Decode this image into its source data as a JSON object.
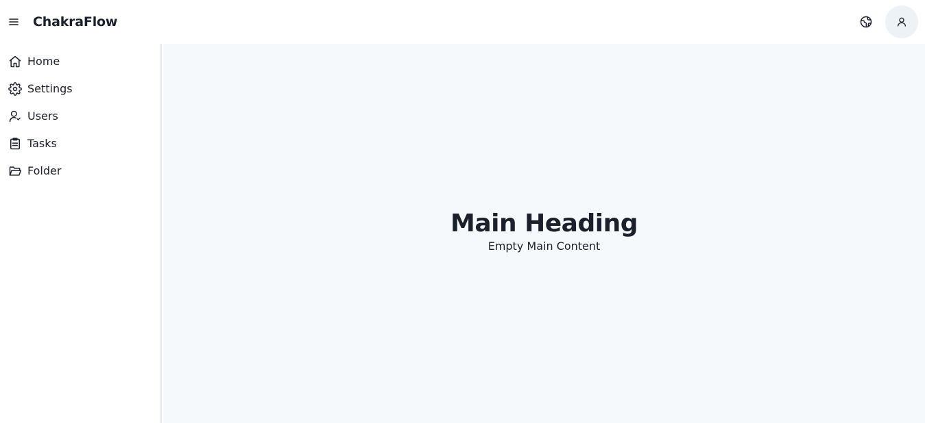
{
  "header": {
    "brand": "ChakraFlow",
    "menu_icon": "hamburger-menu-icon",
    "language_icon": "globe-icon",
    "profile_icon": "user-icon"
  },
  "sidebar": {
    "items": [
      {
        "label": "Home",
        "icon": "home-icon"
      },
      {
        "label": "Settings",
        "icon": "gear-icon"
      },
      {
        "label": "Users",
        "icon": "user-icon"
      },
      {
        "label": "Tasks",
        "icon": "clipboard-icon"
      },
      {
        "label": "Folder",
        "icon": "folder-open-icon"
      }
    ]
  },
  "main": {
    "title": "Main Heading",
    "subtitle": "Empty Main Content"
  },
  "colors": {
    "text": "#1a202c",
    "main_background": "#f6f9fc",
    "avatar_background": "#edf2f7",
    "divider": "#e2e8f0"
  }
}
